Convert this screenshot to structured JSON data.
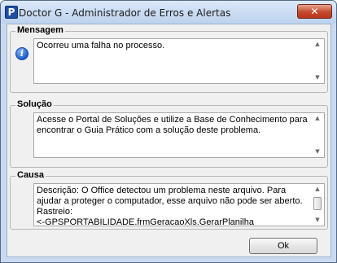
{
  "window": {
    "title": "Doctor G - Administrador de Erros e Alertas",
    "icon_letter": "P",
    "close_glyph": "✕"
  },
  "mensagem": {
    "label": "Mensagem",
    "icon": "info-icon",
    "text": "Ocorreu uma falha no processo."
  },
  "solucao": {
    "label": "Solução",
    "text": "Acesse o Portal de Soluções e utilize a Base de Conhecimento para encontrar o Guia Prático com a solução deste problema."
  },
  "causa": {
    "label": "Causa",
    "text": "Descrição: O Office detectou um problema neste arquivo. Para ajudar a proteger o computador, esse arquivo não pode ser aberto.\nRastreio:\n<-GPSPORTABILIDADE.frmGeracaoXls.GerarPlanilha"
  },
  "ok_button": {
    "label": "Ok"
  },
  "colors": {
    "titlebar": "#c9daf0",
    "close_button": "#c5492d",
    "client_bg": "#f0f0f0"
  }
}
